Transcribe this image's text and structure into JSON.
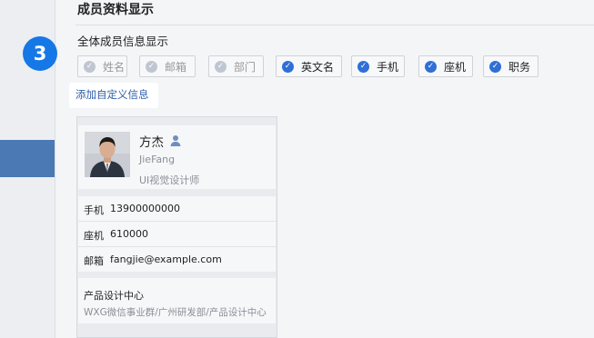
{
  "step": {
    "number": "3",
    "color": "#1677e6"
  },
  "section": {
    "title": "成员资料显示",
    "subtitle": "全体成员信息显示"
  },
  "fields": [
    {
      "label": "姓名",
      "checked": false,
      "locked": true
    },
    {
      "label": "邮箱",
      "checked": false,
      "locked": true
    },
    {
      "label": "部门",
      "checked": false,
      "locked": true
    },
    {
      "label": "英文名",
      "checked": true,
      "locked": false
    },
    {
      "label": "手机",
      "checked": true,
      "locked": false
    },
    {
      "label": "座机",
      "checked": true,
      "locked": false
    },
    {
      "label": "职务",
      "checked": true,
      "locked": false
    }
  ],
  "add_custom_link": "添加自定义信息",
  "card": {
    "name": "方杰",
    "english_name": "JieFang",
    "job_title": "UI视觉设计师",
    "contact_icon": "person-icon",
    "rows": [
      {
        "key": "手机",
        "value": "13900000000"
      },
      {
        "key": "座机",
        "value": "610000"
      },
      {
        "key": "邮箱",
        "value": "fangjie@example.com"
      }
    ],
    "department": "产品设计中心",
    "department_path": "WXG微信事业群/广州研发部/产品设计中心"
  },
  "colors": {
    "accent": "#4a79b4",
    "check_on": "#2f6fd6",
    "check_off": "#bfc6d2",
    "link": "#2f5fa8"
  }
}
